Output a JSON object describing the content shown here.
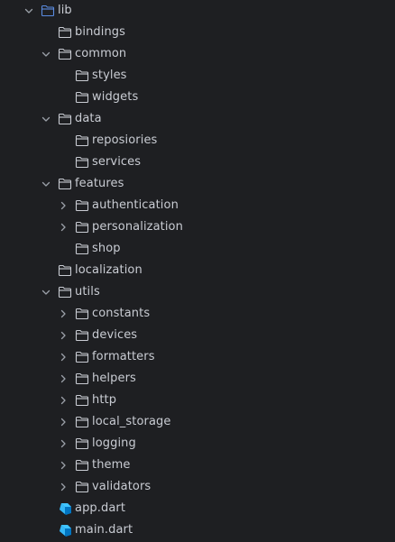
{
  "colors": {
    "background": "#1e1f22",
    "text": "#c9ccd3",
    "folder_stroke": "#c9ccd3",
    "root_folder_stroke": "#5a8be0",
    "chevron": "#9aa0a8",
    "dart_blue_light": "#40c4ff",
    "dart_blue_dark": "#0175c2"
  },
  "tree": {
    "root": {
      "label": "lib",
      "icon": "folder-icon",
      "expanded": true
    },
    "items": [
      {
        "label": "bindings",
        "icon": "folder-icon",
        "depth": 1,
        "chevron": "none"
      },
      {
        "label": "common",
        "icon": "folder-icon",
        "depth": 1,
        "chevron": "expanded"
      },
      {
        "label": "styles",
        "icon": "folder-icon",
        "depth": 2,
        "chevron": "none"
      },
      {
        "label": "widgets",
        "icon": "folder-icon",
        "depth": 2,
        "chevron": "none"
      },
      {
        "label": "data",
        "icon": "folder-icon",
        "depth": 1,
        "chevron": "expanded"
      },
      {
        "label": "reposiories",
        "icon": "folder-icon",
        "depth": 2,
        "chevron": "none"
      },
      {
        "label": "services",
        "icon": "folder-icon",
        "depth": 2,
        "chevron": "none"
      },
      {
        "label": "features",
        "icon": "folder-icon",
        "depth": 1,
        "chevron": "expanded"
      },
      {
        "label": "authentication",
        "icon": "folder-icon",
        "depth": 2,
        "chevron": "collapsed"
      },
      {
        "label": "personalization",
        "icon": "folder-icon",
        "depth": 2,
        "chevron": "collapsed"
      },
      {
        "label": "shop",
        "icon": "folder-icon",
        "depth": 2,
        "chevron": "none"
      },
      {
        "label": "localization",
        "icon": "folder-icon",
        "depth": 1,
        "chevron": "none"
      },
      {
        "label": "utils",
        "icon": "folder-icon",
        "depth": 1,
        "chevron": "expanded"
      },
      {
        "label": "constants",
        "icon": "folder-icon",
        "depth": 2,
        "chevron": "collapsed"
      },
      {
        "label": "devices",
        "icon": "folder-icon",
        "depth": 2,
        "chevron": "collapsed"
      },
      {
        "label": "formatters",
        "icon": "folder-icon",
        "depth": 2,
        "chevron": "collapsed"
      },
      {
        "label": "helpers",
        "icon": "folder-icon",
        "depth": 2,
        "chevron": "collapsed"
      },
      {
        "label": "http",
        "icon": "folder-icon",
        "depth": 2,
        "chevron": "collapsed"
      },
      {
        "label": "local_storage",
        "icon": "folder-icon",
        "depth": 2,
        "chevron": "collapsed"
      },
      {
        "label": "logging",
        "icon": "folder-icon",
        "depth": 2,
        "chevron": "collapsed"
      },
      {
        "label": "theme",
        "icon": "folder-icon",
        "depth": 2,
        "chevron": "collapsed"
      },
      {
        "label": "validators",
        "icon": "folder-icon",
        "depth": 2,
        "chevron": "collapsed"
      },
      {
        "label": "app.dart",
        "icon": "dart-file-icon",
        "depth": 1,
        "chevron": "none"
      },
      {
        "label": "main.dart",
        "icon": "dart-file-icon",
        "depth": 1,
        "chevron": "none"
      }
    ]
  }
}
